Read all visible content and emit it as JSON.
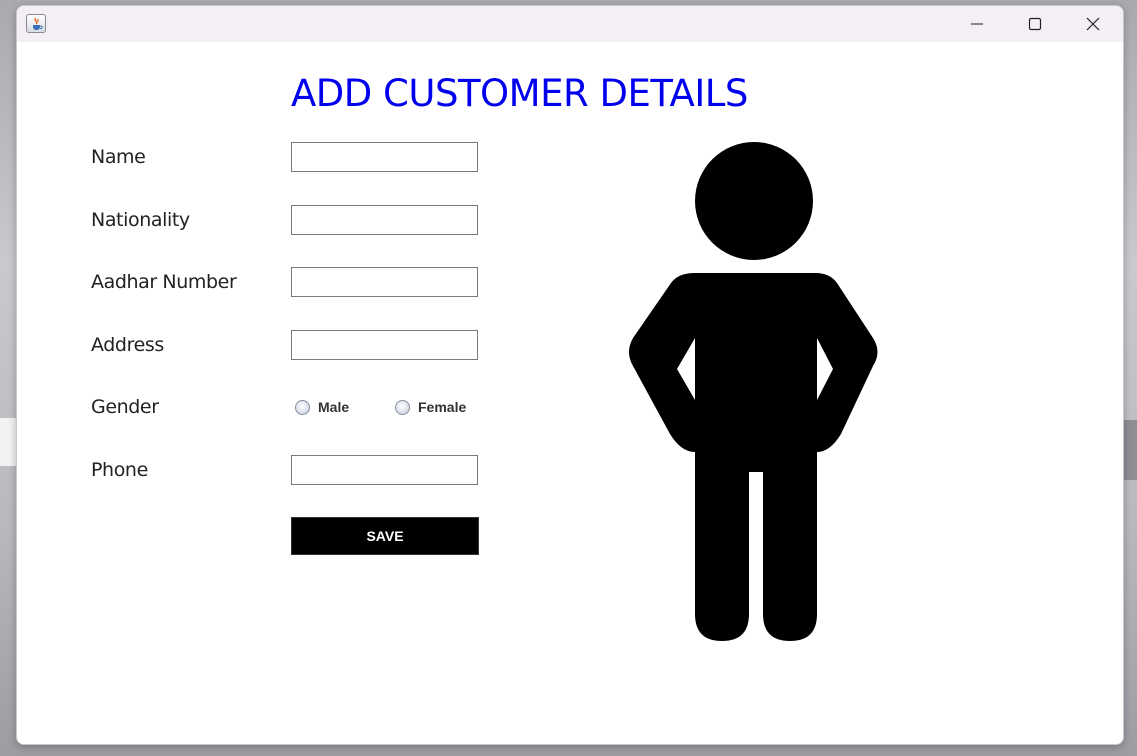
{
  "window": {
    "icon": "java-cup-icon",
    "controls": [
      "minimize-icon",
      "maximize-icon",
      "close-icon"
    ]
  },
  "form": {
    "title": "ADD CUSTOMER DETAILS",
    "fields": {
      "name": {
        "label": "Name",
        "value": ""
      },
      "nationality": {
        "label": "Nationality",
        "value": ""
      },
      "aadhar": {
        "label": "Aadhar Number",
        "value": ""
      },
      "address": {
        "label": "Address",
        "value": ""
      },
      "phone": {
        "label": "Phone",
        "value": ""
      }
    },
    "gender": {
      "label": "Gender",
      "options": [
        "Male",
        "Female"
      ]
    },
    "save_label": "SAVE"
  },
  "illustration": {
    "icon": "person-standing-icon"
  },
  "colors": {
    "title": "#0000ee",
    "save_bg": "#000000",
    "save_text": "#ffffff"
  }
}
